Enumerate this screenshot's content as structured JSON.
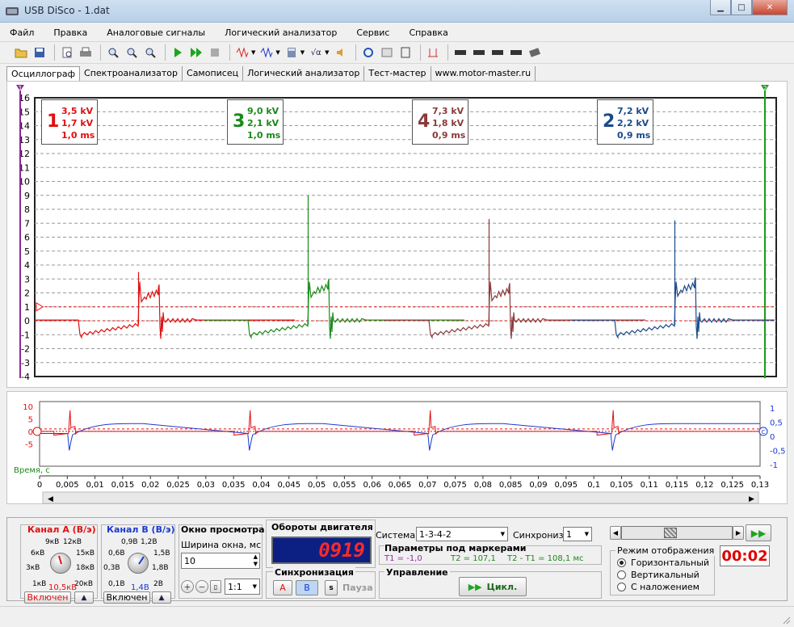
{
  "window": {
    "title": "USB DiSco - 1.dat"
  },
  "menu": [
    "Файл",
    "Правка",
    "Аналоговые сигналы",
    "Логический анализатор",
    "Сервис",
    "Справка"
  ],
  "tabs": [
    "Осциллограф",
    "Спектроанализатор",
    "Самописец",
    "Логический анализатор",
    "Тест-мастер",
    "www.motor-master.ru"
  ],
  "channels": [
    {
      "num": "1",
      "v1": "3,5 kV",
      "v2": "1,7 kV",
      "v3": "1,0 ms",
      "color": "#e01010"
    },
    {
      "num": "3",
      "v1": "9,0 kV",
      "v2": "2,1 kV",
      "v3": "1,0 ms",
      "color": "#1a8a1a"
    },
    {
      "num": "4",
      "v1": "7,3 kV",
      "v2": "1,8 kV",
      "v3": "0,9 ms",
      "color": "#8b3a3a"
    },
    {
      "num": "2",
      "v1": "7,2 kV",
      "v2": "2,2 kV",
      "v3": "0,9 ms",
      "color": "#1a4a8a"
    }
  ],
  "main_axis": {
    "y_ticks": [
      "16",
      "15",
      "14",
      "13",
      "12",
      "11",
      "10",
      "9",
      "8",
      "7",
      "6",
      "5",
      "4",
      "3",
      "2",
      "1",
      "0",
      "-1",
      "-2",
      "-3",
      "-4"
    ],
    "ylim": [
      -4,
      16
    ]
  },
  "marker_labels": {
    "left": "1",
    "right": "2"
  },
  "overview": {
    "left_ticks": [
      "10",
      "5",
      "0",
      "-5"
    ],
    "right_ticks": [
      "1",
      "0,5",
      "0",
      "-0,5",
      "-1"
    ],
    "x_ticks": [
      "0",
      "0,005",
      "0,01",
      "0,015",
      "0,02",
      "0,025",
      "0,03",
      "0,035",
      "0,04",
      "0,045",
      "0,05",
      "0,055",
      "0,06",
      "0,065",
      "0,07",
      "0,075",
      "0,08",
      "0,085",
      "0,09",
      "0,095",
      "0,1",
      "0,105",
      "0,11",
      "0,115",
      "0,12",
      "0,125",
      "0,13"
    ],
    "time_label": "Время, с",
    "marker_c": "C"
  },
  "channel_a": {
    "title": "Канал A (В/э)",
    "scale_labels": [
      "9кВ",
      "12кВ",
      "6кВ",
      "15кВ",
      "3кВ",
      "18кВ",
      "1кВ",
      "20кВ"
    ],
    "value": "10,5кВ",
    "button": "Включен"
  },
  "channel_b": {
    "title": "Канал B (В/э)",
    "scale_labels": [
      "0,9В",
      "1,2В",
      "0,6В",
      "1,5В",
      "0,3В",
      "1,8В",
      "0,1В",
      "2В"
    ],
    "value": "1,4В",
    "button": "Включен"
  },
  "view_window": {
    "title": "Окно просмотра",
    "width_label": "Ширина окна, мс",
    "width_value": "10",
    "zoom_value": "1:1"
  },
  "rpm": {
    "title": "Обороты двигателя",
    "value": "0919"
  },
  "sync": {
    "title": "Синхронизация",
    "a": "A",
    "b": "B",
    "s": "s",
    "pause": "Пауза"
  },
  "system": {
    "label": "Система",
    "value": "1-3-4-2",
    "sync_label": "Синхрониз.",
    "sync_value": "1"
  },
  "markers_params": {
    "title": "Параметры под маркерами",
    "t1": "T1 = -1,0",
    "t2": "T2 = 107,1",
    "dt": "T2 - T1 = 108,1 мс"
  },
  "control": {
    "title": "Управление",
    "cycle_button": "Цикл."
  },
  "display_mode": {
    "title": "Режим отображения",
    "options": [
      "Горизонтальный",
      "Вертикальный",
      "С наложением"
    ],
    "selected": 0
  },
  "timer": "00:02"
}
